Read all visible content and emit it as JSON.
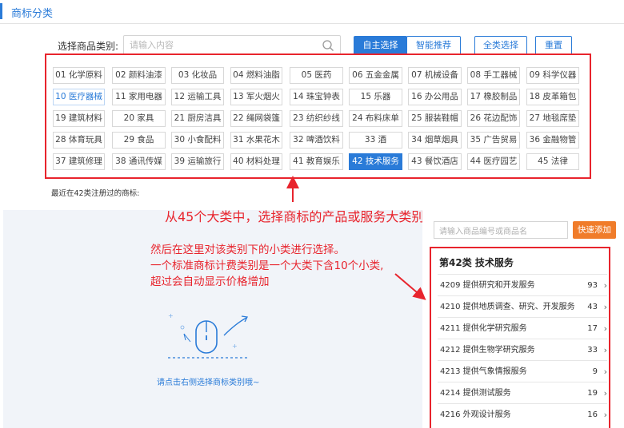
{
  "header": {
    "title": "商标分类"
  },
  "search": {
    "label": "选择商品类别:",
    "placeholder": "请输入内容"
  },
  "buttons": {
    "self_select": "自主选择",
    "smart_recommend": "智能推荐",
    "select_all": "全类选择",
    "reset": "重置"
  },
  "categories": [
    "01 化学原料",
    "02 颜料油漆",
    "03 化妆品",
    "04 燃料油脂",
    "05 医药",
    "06 五金金属",
    "07 机械设备",
    "08 手工器械",
    "09 科学仪器",
    "10 医疗器械",
    "11 家用电器",
    "12 运输工具",
    "13 军火烟火",
    "14 珠宝钟表",
    "15 乐器",
    "16 办公用品",
    "17 橡胶制品",
    "18 皮革箱包",
    "19 建筑材料",
    "20 家具",
    "21 厨房洁具",
    "22 绳网袋篷",
    "23 纺织纱线",
    "24 布料床单",
    "25 服装鞋帽",
    "26 花边配饰",
    "27 地毯席垫",
    "28 体育玩具",
    "29 食品",
    "30 小食配料",
    "31 水果花木",
    "32 啤酒饮料",
    "33 酒",
    "34 烟草烟具",
    "35 广告贸易",
    "36 金融物管",
    "37 建筑修理",
    "38 通讯传媒",
    "39 运输旅行",
    "40 材料处理",
    "41 教育娱乐",
    "42 技术服务",
    "43 餐饮酒店",
    "44 医疗园艺",
    "45 法律"
  ],
  "highlighted_category": "10 医疗器械",
  "active_category": "42 技术服务",
  "recent_text": "最近在42类注册过的商标:",
  "annotations": {
    "main": "从45个大类中，选择商标的产品或服务大类别",
    "sub_lines": [
      "然后在这里对该类别下的小类进行选择。",
      "一个标准商标计费类别是一个大类下含10个小类,",
      "超过会自动显示价格增加"
    ]
  },
  "hint": "请点击右侧选择商标类别哦~",
  "right_panel": {
    "search_placeholder": "请输入商品编号或商品名",
    "quick_add": "快速添加",
    "title": "第42类 技术服务",
    "items": [
      {
        "name": "4209 提供研究和开发服务",
        "count": "93"
      },
      {
        "name": "4210 提供地质调查、研究、开发服务",
        "count": "43"
      },
      {
        "name": "4211 提供化学研究服务",
        "count": "17"
      },
      {
        "name": "4212 提供生物学研究服务",
        "count": "33"
      },
      {
        "name": "4213 提供气象情报服务",
        "count": "9"
      },
      {
        "name": "4214 提供测试服务",
        "count": "19"
      },
      {
        "name": "4216 外观设计服务",
        "count": "16"
      }
    ]
  },
  "colors": {
    "accent": "#2a7bd8",
    "annotation_red": "#e8242d",
    "quick_add_orange": "#f07c2a"
  }
}
